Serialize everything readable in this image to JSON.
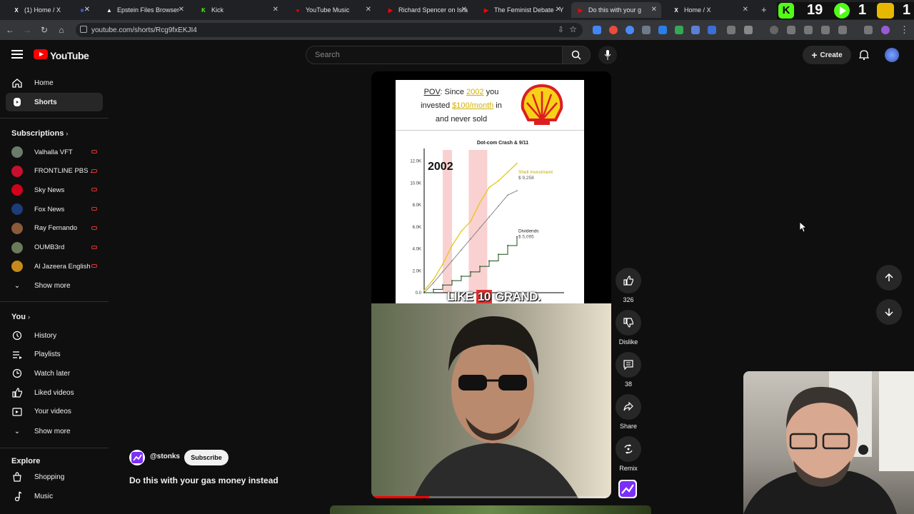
{
  "browser": {
    "tabs": [
      {
        "title": "(1) Home / X",
        "favicon": "X",
        "color": "#ffffff"
      },
      {
        "title": "",
        "favicon": "■",
        "color": "#3c5bd8"
      },
      {
        "title": "Epstein Files Browser",
        "favicon": "▲",
        "color": "#ffffff"
      },
      {
        "title": "Kick",
        "favicon": "K",
        "color": "#53fc18"
      },
      {
        "title": "YouTube Music",
        "favicon": "●",
        "color": "#ff0000"
      },
      {
        "title": "Richard Spencer on Isra",
        "favicon": "▶",
        "color": "#ff0000"
      },
      {
        "title": "The Feminist Debate - Y",
        "favicon": "▶",
        "color": "#ff0000"
      },
      {
        "title": "Do this with your g",
        "favicon": "▶",
        "color": "#ff0000"
      },
      {
        "title": "Home / X",
        "favicon": "X",
        "color": "#ffffff"
      }
    ],
    "url": "youtube.com/shorts/Rcg9fxEKJI4",
    "overlay_counter": "19",
    "overlay_counter2": "1",
    "overlay_counter3": "1"
  },
  "header": {
    "logo": "YouTube",
    "search_placeholder": "Search",
    "create_label": "Create"
  },
  "sidebar": {
    "main": [
      {
        "label": "Home",
        "icon": "home-icon"
      },
      {
        "label": "Shorts",
        "icon": "shorts-icon"
      }
    ],
    "subscriptions_title": "Subscriptions",
    "subscriptions": [
      {
        "label": "Valhalla VFT",
        "color": "#6b7b6b"
      },
      {
        "label": "FRONTLINE PBS ...",
        "color": "#c8102e"
      },
      {
        "label": "Sky News",
        "color": "#d0021b"
      },
      {
        "label": "Fox News",
        "color": "#1d3c78"
      },
      {
        "label": "Ray Fernando",
        "color": "#8a5a3a"
      },
      {
        "label": "OUMB3rd",
        "color": "#6a7a5a"
      },
      {
        "label": "Al Jazeera English",
        "color": "#c48a1a"
      }
    ],
    "show_more": "Show more",
    "you_title": "You",
    "you_items": [
      {
        "label": "History",
        "icon": "history-icon"
      },
      {
        "label": "Playlists",
        "icon": "playlists-icon"
      },
      {
        "label": "Watch later",
        "icon": "watch-later-icon"
      },
      {
        "label": "Liked videos",
        "icon": "liked-videos-icon"
      },
      {
        "label": "Your videos",
        "icon": "your-videos-icon"
      }
    ],
    "show_more_2": "Show more",
    "explore_title": "Explore",
    "explore_items": [
      {
        "label": "Shopping",
        "icon": "shopping-icon"
      },
      {
        "label": "Music",
        "icon": "music-icon"
      }
    ]
  },
  "short": {
    "channel": "@stonks",
    "subscribe_label": "Subscribe",
    "title": "Do this with your gas money instead",
    "caption_pre": "LIKE ",
    "caption_hl": "10",
    "caption_post": " GRAND.",
    "progress_fraction": 0.24,
    "panel": {
      "pov": "POV",
      "line1_a": ": Since ",
      "line1_year": "2002",
      "line1_b": " you",
      "line2_a": "invested ",
      "line2_amt": "$100/month",
      "line2_b": " in",
      "line3": "and never sold",
      "logo": "shell-logo-icon"
    }
  },
  "actions": {
    "likes": "326",
    "dislike": "Dislike",
    "comments": "38",
    "share": "Share",
    "remix": "Remix"
  },
  "chart_data": {
    "type": "line",
    "title": "Dot-com Crash & 9/11",
    "year_label": "2002",
    "ylim": [
      0,
      12500
    ],
    "yticks": [
      "0.0",
      "2.0K",
      "4.0K",
      "6.0K",
      "8.0K",
      "10.0K",
      "12.0K"
    ],
    "x": [
      0,
      0.1,
      0.2,
      0.3,
      0.4,
      0.5,
      0.6,
      0.7,
      0.8,
      0.9,
      1.0
    ],
    "series": [
      {
        "name": "Shell Investment",
        "end_label": "$ 9,258",
        "color": "#e6c619",
        "values": [
          200,
          1200,
          2600,
          4300,
          5600,
          6500,
          8200,
          9600,
          10200,
          11000,
          11800
        ]
      },
      {
        "name": "",
        "color": "#888888",
        "values": [
          0,
          900,
          1900,
          2900,
          3900,
          4900,
          5900,
          6900,
          7900,
          8900,
          9300
        ]
      },
      {
        "name": "Dividends",
        "end_label": "$ 5,095",
        "color": "#1a4d1a",
        "values": [
          0,
          300,
          700,
          1100,
          1500,
          1900,
          2400,
          2900,
          3500,
          4300,
          5100
        ]
      }
    ],
    "shaded_regions": [
      [
        0.2,
        0.3
      ],
      [
        0.48,
        0.68
      ]
    ]
  },
  "colors": {
    "accent": "#ff0000",
    "background": "#0f0f0f"
  }
}
